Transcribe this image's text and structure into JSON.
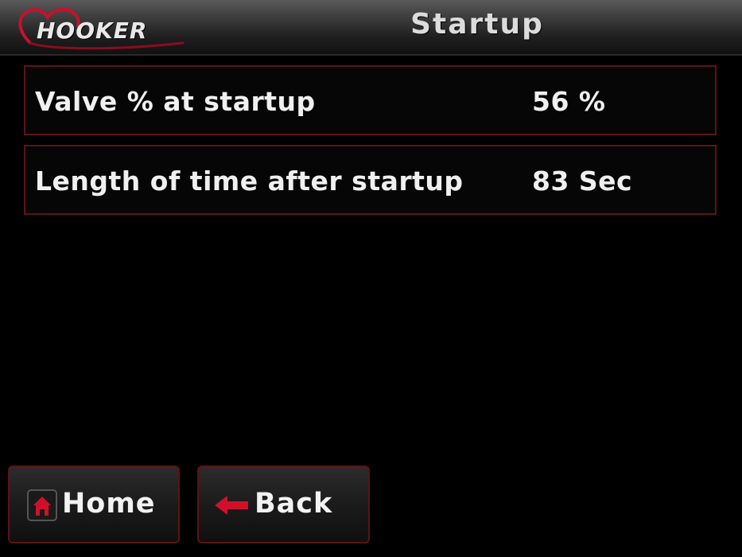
{
  "header": {
    "brand": "HOOKER",
    "title": "Startup"
  },
  "settings": [
    {
      "label": "Valve % at startup",
      "value": "56 %"
    },
    {
      "label": "Length of time after startup",
      "value": "83 Sec"
    }
  ],
  "nav": {
    "home_label": "Home",
    "back_label": "Back"
  },
  "colors": {
    "accent": "#c8102e",
    "border": "#5c1414",
    "background": "#000000",
    "text": "#f0f0f0"
  },
  "icons": {
    "logo": "heart-logo",
    "home": "home-icon",
    "back": "arrow-left-icon"
  }
}
